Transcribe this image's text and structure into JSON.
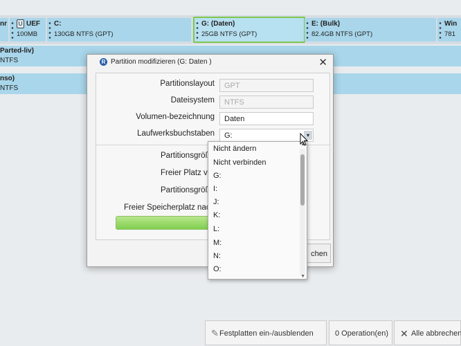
{
  "partitions": [
    {
      "name": "nr",
      "info": ""
    },
    {
      "name": "UEF",
      "info": "100MB"
    },
    {
      "name": "C:",
      "info": "130GB NTFS (GPT)"
    },
    {
      "name": "G: (Daten)",
      "info": "25GB NTFS (GPT)"
    },
    {
      "name": "E: (Bulk)",
      "info": "82.4GB NTFS (GPT)"
    },
    {
      "name": "Win",
      "info": "781"
    }
  ],
  "disk_rows": [
    {
      "title": "Parted-liv)",
      "sub": "NTFS"
    },
    {
      "title": "nso)",
      "sub": "NTFS"
    }
  ],
  "dialog": {
    "title": "Partition modifizieren (G: Daten )",
    "close": "✕",
    "labels": {
      "layout": "Partitionslayout",
      "fs": "Dateisystem",
      "volume": "Volumen-bezeichnung",
      "drive_letter": "Laufwerksbuchstaben",
      "part_size_1": "Partitionsgröße",
      "free_before": "Freier Platz vor",
      "part_size_2": "Partitionsgröße",
      "free_after": "Freier Speicherplatz nach"
    },
    "values": {
      "layout": "GPT",
      "fs": "NTFS",
      "volume": "Daten",
      "drive_letter": "G:"
    },
    "button_label": "chen"
  },
  "dropdown_options": [
    "Nicht ändern",
    "Nicht verbinden",
    "G:",
    "I:",
    "J:",
    "K:",
    "L:",
    "M:",
    "N:",
    "O:"
  ],
  "toolbar": {
    "toggle_disks": "Festplatten ein-/ausblenden",
    "operations": "0 Operation(en)",
    "cancel_all": "Alle abbrechen"
  }
}
